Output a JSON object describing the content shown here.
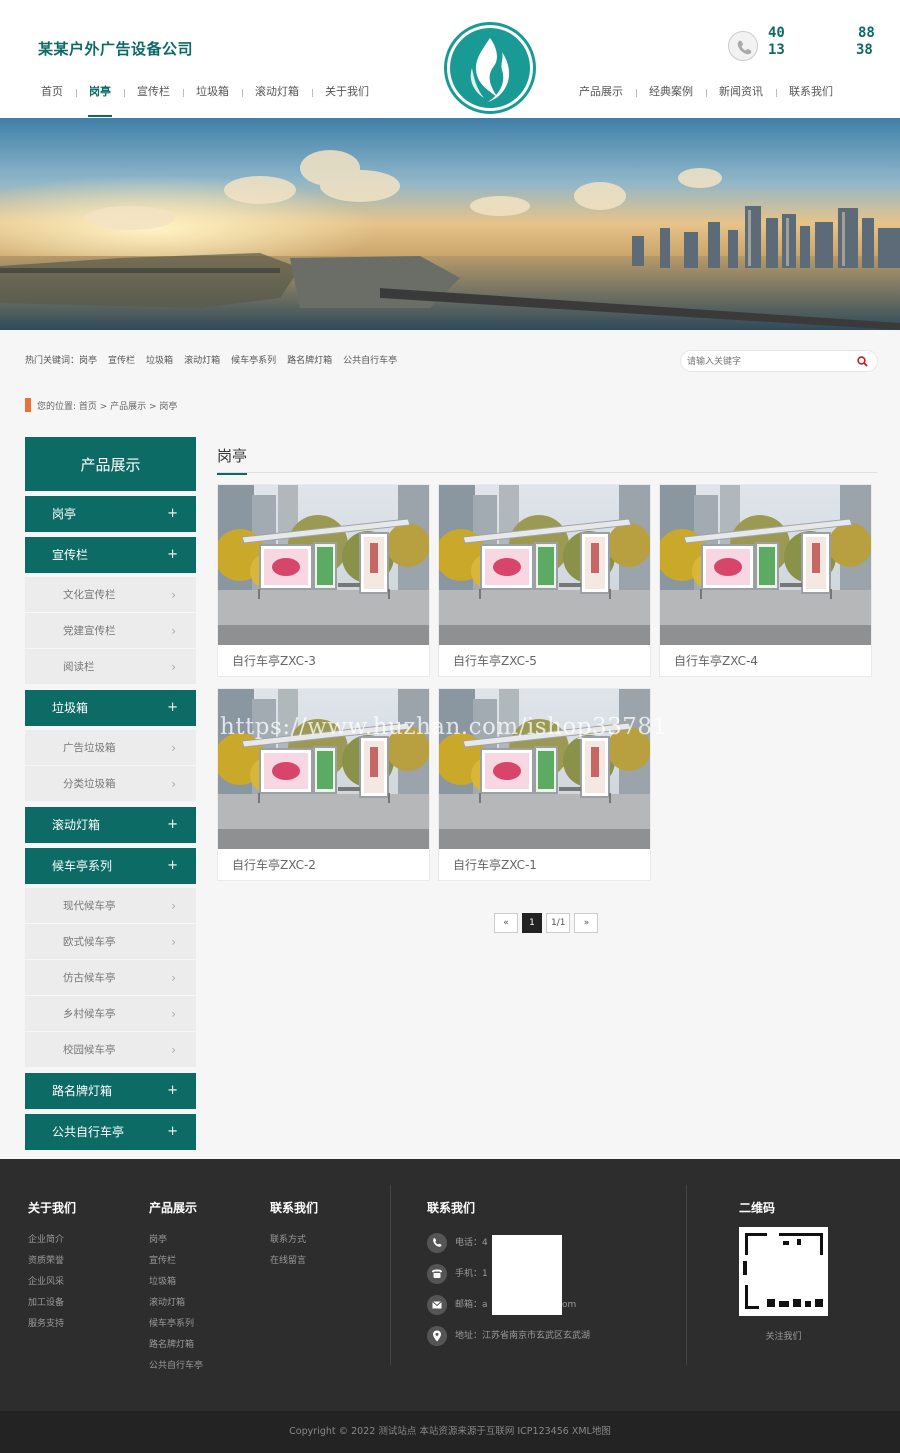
{
  "header": {
    "company": "某某户外广告设备公司",
    "nav_left": [
      "首页",
      "岗亭",
      "宣传栏",
      "垃圾箱",
      "滚动灯箱",
      "关于我们"
    ],
    "nav_right": [
      "产品展示",
      "经典案例",
      "新闻资讯",
      "联系我们"
    ],
    "active_nav": "岗亭",
    "phone_line1_a": "40",
    "phone_line1_b": "88",
    "phone_line2_a": "13",
    "phone_line2_b": "38"
  },
  "keybar": {
    "label": "热门关键词：",
    "keywords": [
      "岗亭",
      "宣传栏",
      "垃圾箱",
      "滚动灯箱",
      "候车亭系列",
      "路名牌灯箱",
      "公共自行车亭"
    ],
    "search_placeholder": "请输入关键字"
  },
  "breadcrumb": "您的位置: 首页 > 产品展示 > 岗亭",
  "sidebar": {
    "title": "产品展示",
    "cats": [
      {
        "label": "岗亭",
        "plus": "+",
        "subs": []
      },
      {
        "label": "宣传栏",
        "plus": "+",
        "subs": [
          "文化宣传栏",
          "党建宣传栏",
          "阅读栏"
        ]
      },
      {
        "label": "垃圾箱",
        "plus": "+",
        "subs": [
          "广告垃圾箱",
          "分类垃圾箱"
        ]
      },
      {
        "label": "滚动灯箱",
        "plus": "+",
        "subs": []
      },
      {
        "label": "候车亭系列",
        "plus": "+",
        "subs": [
          "现代候车亭",
          "欧式候车亭",
          "仿古候车亭",
          "乡村候车亭",
          "校园候车亭"
        ]
      },
      {
        "label": "路名牌灯箱",
        "plus": "+",
        "subs": []
      },
      {
        "label": "公共自行车亭",
        "plus": "+",
        "subs": []
      }
    ],
    "chevron": "›"
  },
  "content": {
    "title": "岗亭",
    "products": [
      "自行车亭ZXC-3",
      "自行车亭ZXC-5",
      "自行车亭ZXC-4",
      "自行车亭ZXC-2",
      "自行车亭ZXC-1"
    ],
    "watermark": "https://www.huzhan.com/ishop33781",
    "pager": {
      "prev": "«",
      "current": "1",
      "total": "1/1",
      "next": "»"
    }
  },
  "footer": {
    "about": {
      "title": "关于我们",
      "links": [
        "企业简介",
        "资质荣誉",
        "企业风采",
        "加工设备",
        "服务支持"
      ]
    },
    "products": {
      "title": "产品展示",
      "links": [
        "岗亭",
        "宣传栏",
        "垃圾箱",
        "滚动灯箱",
        "候车亭系列",
        "路名牌灯箱",
        "公共自行车亭"
      ]
    },
    "contact_links": {
      "title": "联系我们",
      "links": [
        "联系方式",
        "在线留言"
      ]
    },
    "contact": {
      "title": "联系我们",
      "tel": "电话：4",
      "mobile": "手机：1",
      "email_a": "邮箱：a",
      "email_b": "om",
      "address": "地址：江苏省南京市玄武区玄武湖"
    },
    "qr": {
      "title": "二维码",
      "label": "关注我们"
    },
    "copyright": "Copyright © 2022 测试站点 本站资源来源于互联网 ICP123456 XML地图"
  },
  "colors": {
    "primary": "#0d6b66",
    "accent": "#e9723a",
    "footer": "#2d2d2d"
  }
}
